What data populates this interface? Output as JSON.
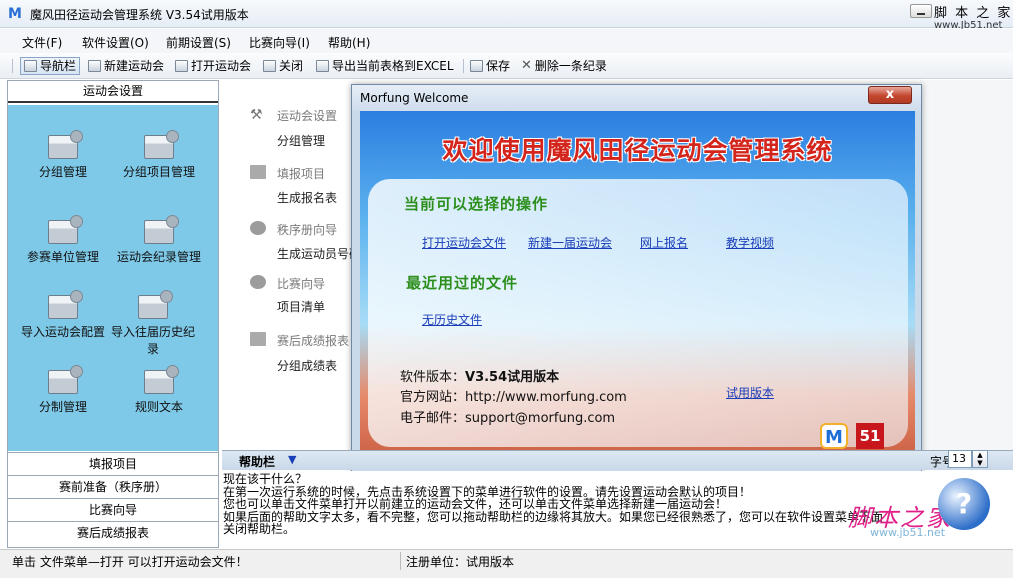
{
  "window": {
    "title": "魔风田径运动会管理系统 V3.54试用版本",
    "logo": "M",
    "watermark_top": "脚 本 之 家",
    "watermark_top_url": "www.Jb51.net"
  },
  "menu": {
    "items": [
      "文件(F)",
      "软件设置(O)",
      "前期设置(S)",
      "比赛向导(I)",
      "帮助(H)"
    ]
  },
  "toolbar": {
    "items": [
      {
        "label": "导航栏",
        "icon": "navigation-icon"
      },
      {
        "label": "新建运动会",
        "icon": "new-doc-icon"
      },
      {
        "label": "打开运动会",
        "icon": "folder-open-icon"
      },
      {
        "label": "关闭",
        "icon": "folder-close-icon"
      },
      {
        "label": "导出当前表格到EXCEL",
        "icon": "excel-export-icon"
      },
      {
        "label": "保存",
        "icon": "save-icon"
      },
      {
        "label": "删除一条纪录",
        "icon": "delete-icon"
      }
    ]
  },
  "left_panel": {
    "header": "运动会设置",
    "grid_items": [
      {
        "label": "分组管理"
      },
      {
        "label": "分组项目管理"
      },
      {
        "label": "参赛单位管理"
      },
      {
        "label": "运动会纪录管理"
      },
      {
        "label": "导入运动会配置"
      },
      {
        "label": "导入往届历史纪录"
      },
      {
        "label": "分制管理"
      },
      {
        "label": "规则文本"
      }
    ],
    "bottom_buttons": [
      "填报项目",
      "赛前准备（秩序册）",
      "比赛向导",
      "赛后成绩报表"
    ]
  },
  "mid_nav": {
    "sections": [
      {
        "head": "运动会设置",
        "sub": "分组管理"
      },
      {
        "head": "填报项目",
        "sub": "生成报名表"
      },
      {
        "head": "秩序册向导",
        "sub": "生成运动员号码"
      },
      {
        "head": "比赛向导",
        "sub": "项目清单"
      },
      {
        "head": "赛后成绩报表",
        "sub": "分组成绩表"
      }
    ]
  },
  "dialog": {
    "title": "Morfung Welcome",
    "close_label": "x",
    "headline": "欢迎使用魔风田径运动会管理系统",
    "section_actions": "当前可以选择的操作",
    "actions": [
      "打开运动会文件",
      "新建一届运动会",
      "网上报名",
      "教学视频"
    ],
    "section_recent": "最近用过的文件",
    "recent": "无历史文件",
    "version_label": "软件版本：",
    "version_value": "V3.54试用版本",
    "site_label": "官方网站：",
    "site_value": "http://www.morfung.com",
    "email_label": "电子邮件：",
    "email_value": "support@morfung.com",
    "trial_link": "试用版本",
    "logo_m": "M",
    "logo_51": "51"
  },
  "help": {
    "title": "帮助栏",
    "spin_label": "字号：",
    "spin_value": "13",
    "lines": [
      "现在该干什么？",
      "    在第一次运行系统的时候，先点击系统设置下的菜单进行软件的设置。请先设置运动会默认的项目！",
      "    您也可以单击文件菜单打开以前建立的运动会文件，还可以单击文件菜单选择新建一届运动会！",
      "    如果后面的帮助文字太多，看不完整，您可以拖动帮助栏的边缘将其放大。如果您已经很熟悉了，您可以在软件设置菜单下面",
      "关闭帮助栏。"
    ],
    "watermark": "脚本之家",
    "watermark_url": "www.jb51.net"
  },
  "status": {
    "left": "单击 文件菜单—打开 可以打开运动会文件！",
    "right": "注册单位：试用版本"
  }
}
